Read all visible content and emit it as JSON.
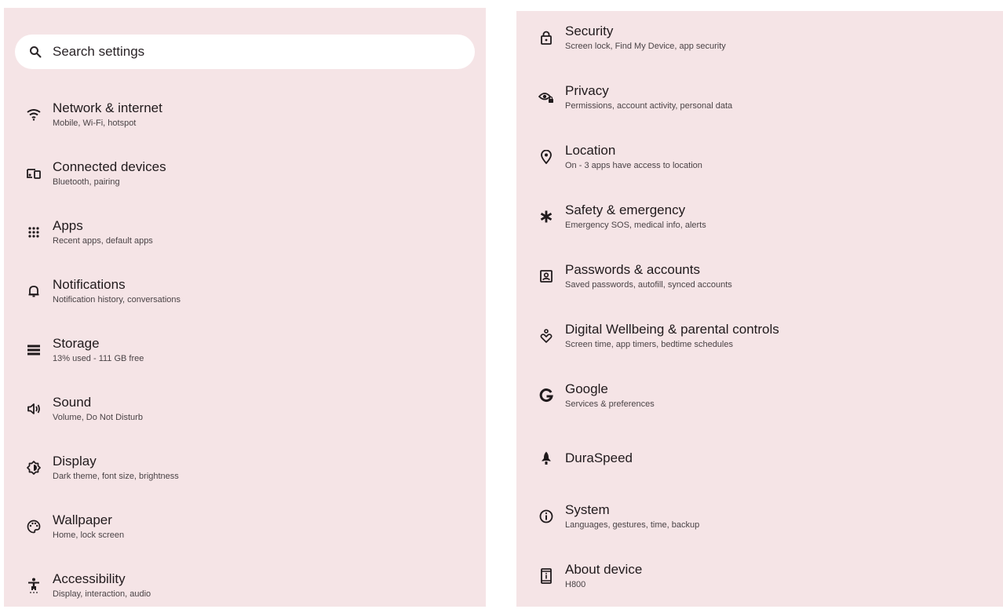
{
  "search": {
    "placeholder": "Search settings"
  },
  "left_items": [
    {
      "title": "Network & internet",
      "subtitle": "Mobile, Wi-Fi, hotspot",
      "icon": "wifi-icon"
    },
    {
      "title": "Connected devices",
      "subtitle": "Bluetooth, pairing",
      "icon": "devices-icon"
    },
    {
      "title": "Apps",
      "subtitle": "Recent apps, default apps",
      "icon": "apps-grid-icon"
    },
    {
      "title": "Notifications",
      "subtitle": "Notification history, conversations",
      "icon": "bell-icon"
    },
    {
      "title": "Storage",
      "subtitle": "13% used - 111 GB free",
      "icon": "storage-icon"
    },
    {
      "title": "Sound",
      "subtitle": "Volume, Do Not Disturb",
      "icon": "volume-icon"
    },
    {
      "title": "Display",
      "subtitle": "Dark theme, font size, brightness",
      "icon": "brightness-icon"
    },
    {
      "title": "Wallpaper",
      "subtitle": "Home, lock screen",
      "icon": "palette-icon"
    },
    {
      "title": "Accessibility",
      "subtitle": "Display, interaction, audio",
      "icon": "accessibility-icon"
    }
  ],
  "right_items": [
    {
      "title": "Security",
      "subtitle": "Screen lock, Find My Device, app security",
      "icon": "lock-icon"
    },
    {
      "title": "Privacy",
      "subtitle": "Permissions, account activity, personal data",
      "icon": "eye-lock-icon"
    },
    {
      "title": "Location",
      "subtitle": "On - 3 apps have access to location",
      "icon": "location-pin-icon"
    },
    {
      "title": "Safety & emergency",
      "subtitle": "Emergency SOS, medical info, alerts",
      "icon": "asterisk-icon"
    },
    {
      "title": "Passwords & accounts",
      "subtitle": "Saved passwords, autofill, synced accounts",
      "icon": "account-box-icon"
    },
    {
      "title": "Digital Wellbeing & parental controls",
      "subtitle": "Screen time, app timers, bedtime schedules",
      "icon": "wellbeing-icon"
    },
    {
      "title": "Google",
      "subtitle": "Services & preferences",
      "icon": "google-g-icon"
    },
    {
      "title": "DuraSpeed",
      "subtitle": "",
      "icon": "rocket-icon"
    },
    {
      "title": "System",
      "subtitle": "Languages, gestures, time, backup",
      "icon": "info-icon"
    },
    {
      "title": "About device",
      "subtitle": "H800",
      "icon": "device-info-icon"
    }
  ],
  "colors": {
    "panel_bg": "#f5e4e6",
    "search_bg": "#ffffff",
    "text": "#201a1c",
    "subtext": "#4a4346"
  }
}
